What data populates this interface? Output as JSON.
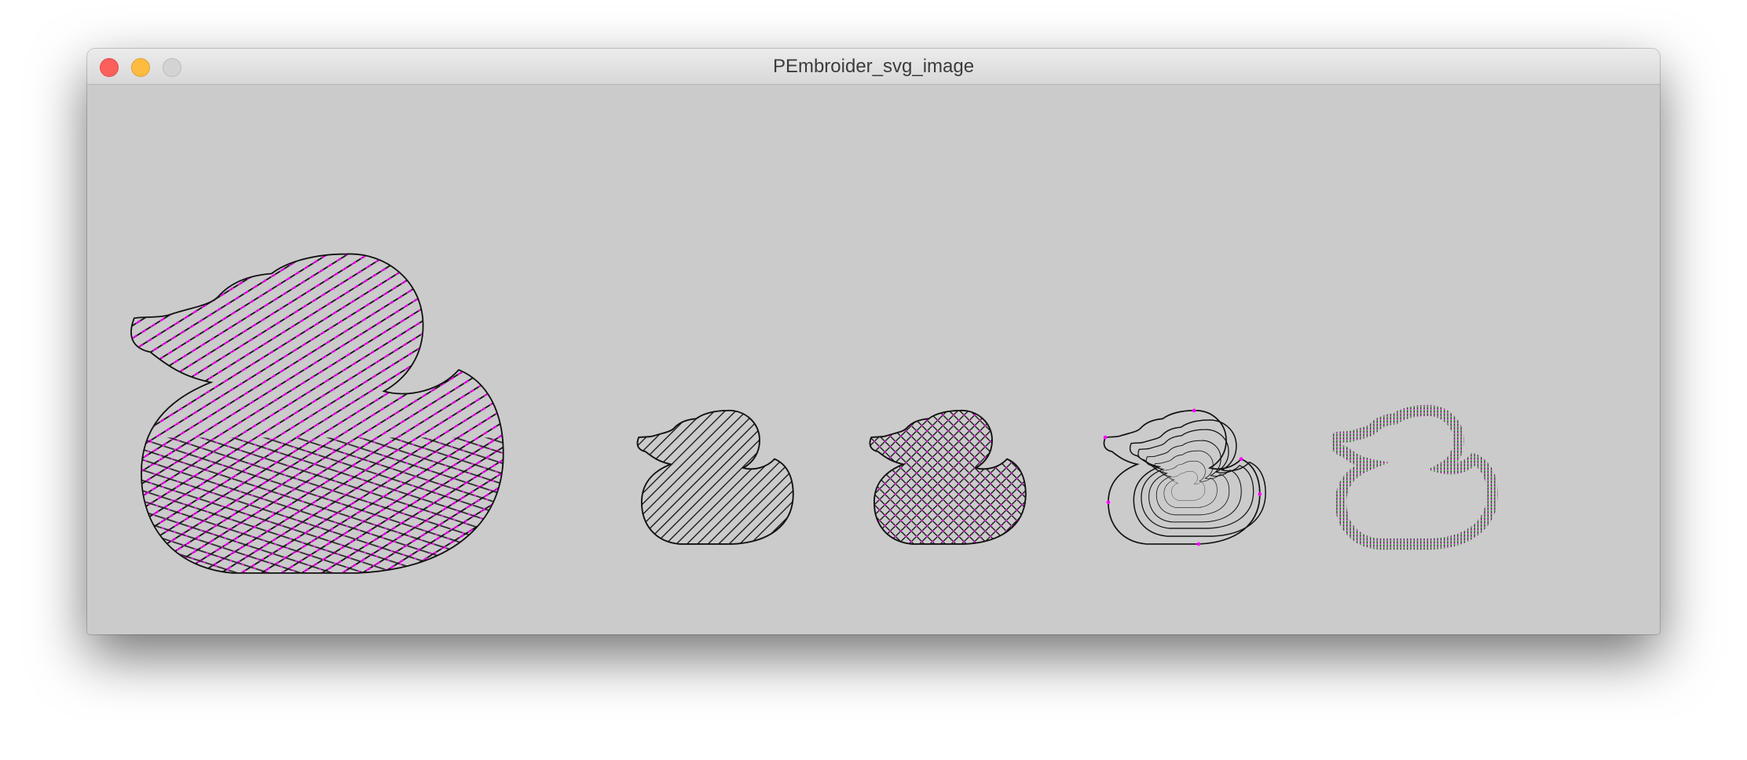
{
  "window": {
    "title": "PEmbroider_svg_image",
    "controls": {
      "close": "close-icon",
      "minimize": "minimize-icon",
      "zoom": "zoom-icon"
    }
  },
  "canvas": {
    "background": "#cbcbcb",
    "stitch_color": "#111111",
    "needle_point_colors": [
      "#ff00ff",
      "#00dd00"
    ],
    "ducks": [
      {
        "fill_style": "flow-field satin"
      },
      {
        "fill_style": "parallel diagonal hatch"
      },
      {
        "fill_style": "cross hatch"
      },
      {
        "fill_style": "concentric contour"
      },
      {
        "fill_style": "satin outline stroke"
      }
    ]
  }
}
